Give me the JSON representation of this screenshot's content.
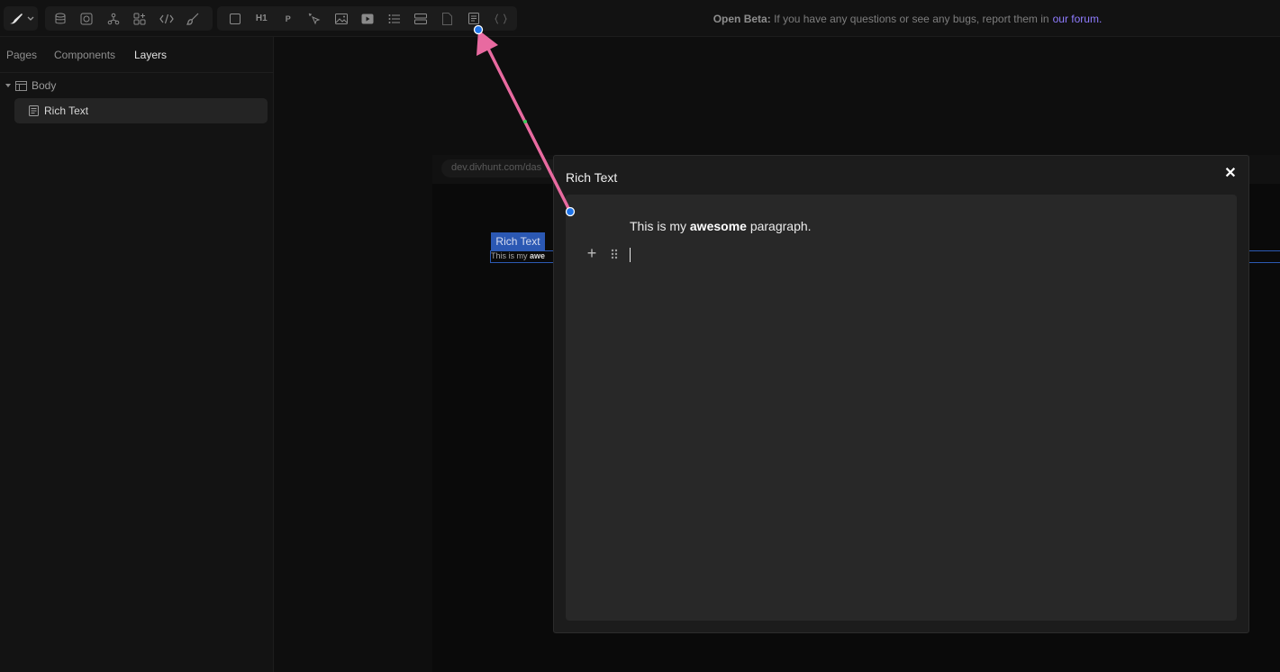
{
  "topbar": {
    "logo_icon": "brush-logo-icon",
    "group1_icons": [
      "database-icon",
      "target-icon",
      "components-icon",
      "apps-icon",
      "code-icon",
      "paint-brush-icon"
    ],
    "h1_label": "H1",
    "p_label": "P",
    "beta_label": "Open Beta:",
    "beta_text": "If you have any questions or see any bugs, report them in",
    "beta_link": "our forum."
  },
  "left_panel": {
    "tabs": [
      "Pages",
      "Components",
      "Layers"
    ],
    "active_tab": "Layers",
    "tree": {
      "root": "Body",
      "child": "Rich Text"
    }
  },
  "canvas": {
    "url": "dev.divhunt.com/das",
    "selected_label": "Rich Text",
    "text_pre": "This is my ",
    "text_bold": "awe"
  },
  "modal": {
    "title": "Rich Text",
    "close_icon": "close-icon",
    "paragraph_pre": "This is my ",
    "paragraph_bold": "awesome",
    "paragraph_post": " paragraph.",
    "add_block_icon": "plus-icon",
    "drag_handle_icon": "drag-handle-icon"
  },
  "annotation": {
    "arrow_color": "#e86aa0",
    "endpoint_color": "#1e73e8"
  },
  "colors": {
    "background": "#0f0f0f",
    "selection_blue": "#2b58b3",
    "link_purple": "#8f7cff"
  }
}
